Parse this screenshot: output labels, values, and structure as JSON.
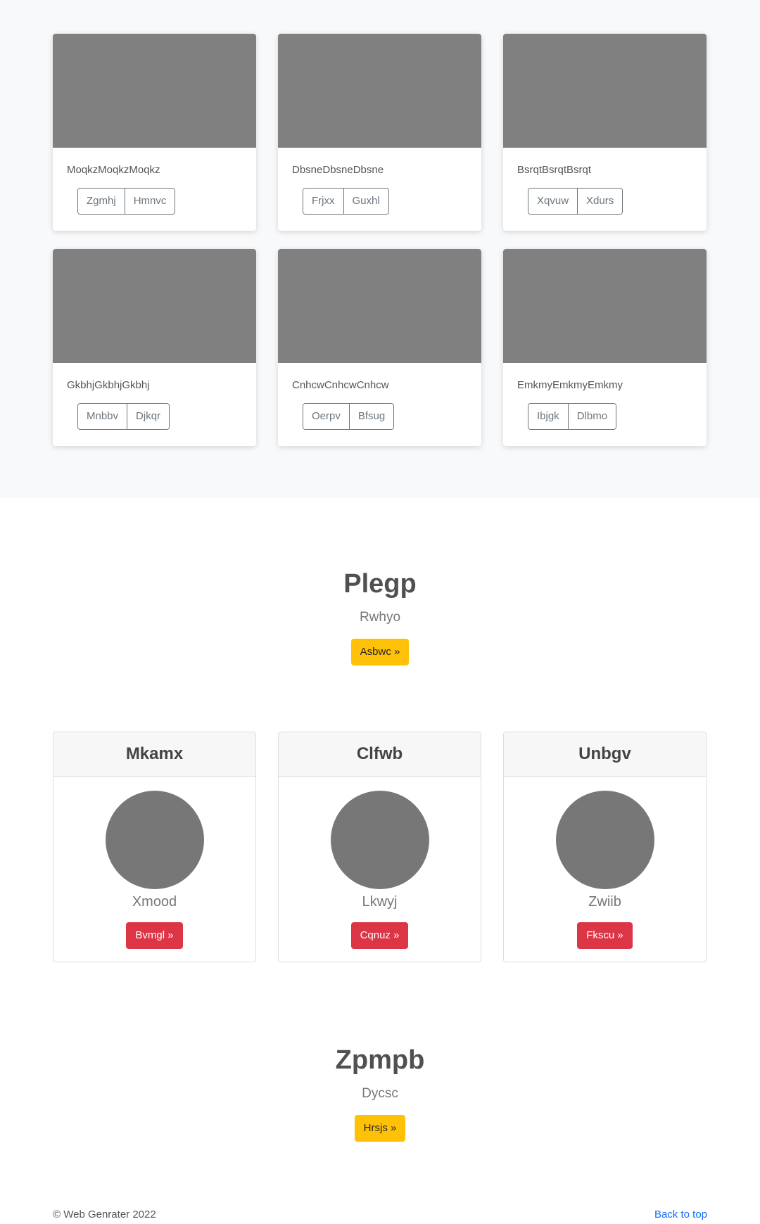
{
  "album": {
    "cards": [
      {
        "text": "MoqkzMoqkzMoqkz",
        "btn1": "Zgmhj",
        "btn2": "Hmnvc"
      },
      {
        "text": "DbsneDbsneDbsne",
        "btn1": "Frjxx",
        "btn2": "Guxhl"
      },
      {
        "text": "BsrqtBsrqtBsrqt",
        "btn1": "Xqvuw",
        "btn2": "Xdurs"
      },
      {
        "text": "GkbhjGkbhjGkbhj",
        "btn1": "Mnbbv",
        "btn2": "Djkqr"
      },
      {
        "text": "CnhcwCnhcwCnhcw",
        "btn1": "Oerpv",
        "btn2": "Bfsug"
      },
      {
        "text": "EmkmyEmkmyEmkmy",
        "btn1": "Ibjgk",
        "btn2": "Dlbmo"
      }
    ]
  },
  "hero1": {
    "title": "Plegp",
    "subtitle": "Rwhyo",
    "button": "Asbwc »"
  },
  "teams": [
    {
      "header": "Mkamx",
      "sub": "Xmood",
      "button": "Bvmgl »"
    },
    {
      "header": "Clfwb",
      "sub": "Lkwyj",
      "button": "Cqnuz »"
    },
    {
      "header": "Unbgv",
      "sub": "Zwiib",
      "button": "Fkscu »"
    }
  ],
  "hero2": {
    "title": "Zpmpb",
    "subtitle": "Dycsc",
    "button": "Hrsjs »"
  },
  "footer": {
    "copyright": "© Web Genrater 2022",
    "back_to_top": "Back to top"
  },
  "colors": {
    "warning": "#ffc107",
    "danger": "#dc3545",
    "link": "#0d6efd",
    "thumb": "#808080"
  }
}
